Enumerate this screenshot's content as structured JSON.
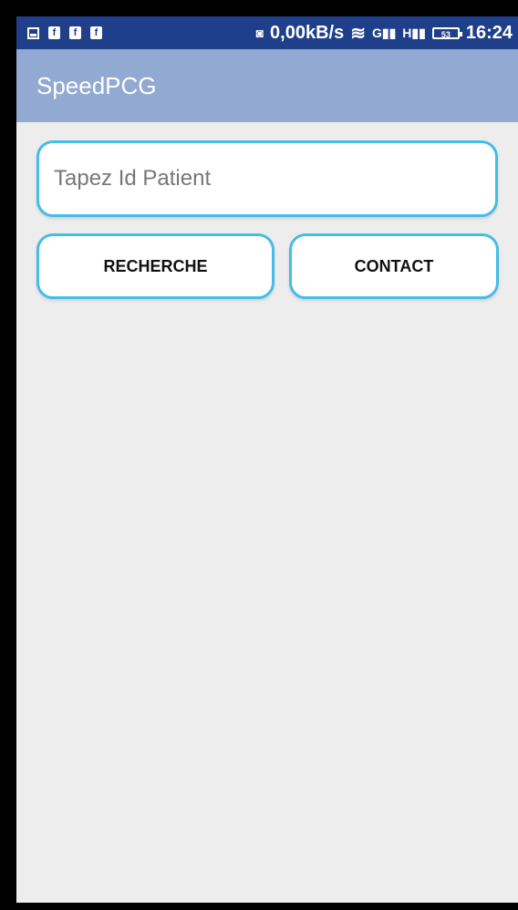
{
  "status_bar": {
    "network_speed": "0,00kB/s",
    "sim_labels": [
      "G",
      "H"
    ],
    "battery": "53",
    "time": "16:24"
  },
  "app": {
    "title": "SpeedPCG"
  },
  "search": {
    "placeholder": "Tapez Id Patient"
  },
  "buttons": {
    "search_label": "RECHERCHE",
    "contact_label": "CONTACT"
  },
  "colors": {
    "status_bar": "#1f3f8a",
    "app_bar": "#92a9d2",
    "accent_border": "#44bde8",
    "background": "#ededed"
  },
  "icons": [
    "gallery-icon",
    "facebook-icon",
    "facebook-icon",
    "facebook-icon",
    "sync-icon",
    "wifi-icon",
    "signal-icon",
    "signal-icon",
    "battery-icon"
  ]
}
